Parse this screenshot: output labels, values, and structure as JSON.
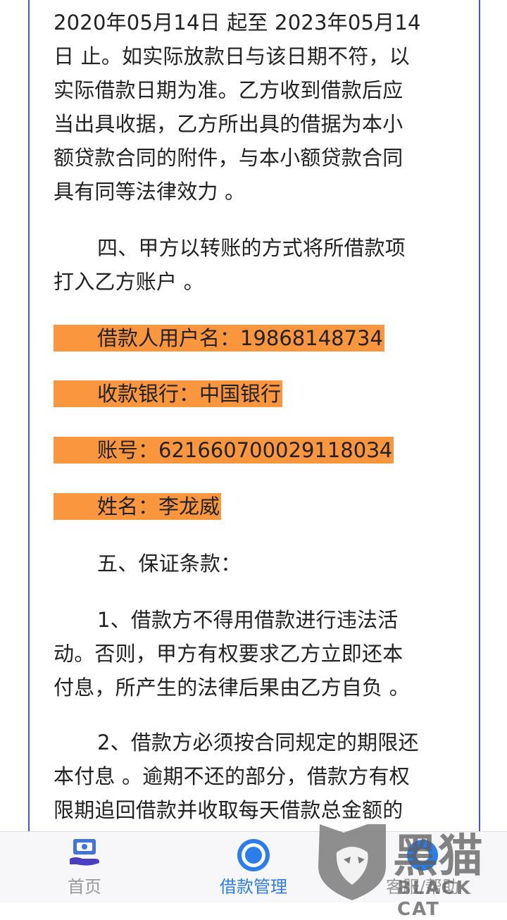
{
  "document": {
    "paragraph_3_lines": [
      "2020年05月14日 起至  2023年05月14",
      "日 止。如实际放款日与该日期不符，以",
      "实际借款日期为准。乙方收到借款后应",
      "当出具收据，乙方所出具的借据为本小",
      "额贷款合同的附件，与本小额贷款合同",
      "具有同等法律效力 。"
    ],
    "paragraph_4_lines": [
      "四、甲方以转账的方式将所借款项",
      "打入乙方账户 。"
    ],
    "account_info": {
      "username": "借款人用户名：19868148734",
      "bank": "收款银行：中国银行",
      "account_no": "账号：6216607000291180З4",
      "name": "姓名：李龙威"
    },
    "section_5_title": "五、保证条款：",
    "clause_1_lines": [
      "1、借款方不得用借款进行违法活",
      "动。否则，甲方有权要求乙方立即还本",
      "付息，所产生的法律后果由乙方自负 。"
    ],
    "clause_2_lines": [
      "2、借款方必须按合同规定的期限还",
      "本付息 。逾期不还的部分，借款方有权",
      "限期追回借款并收取每天借款总金额的"
    ]
  },
  "tabbar": {
    "tabs": [
      {
        "label": "首页",
        "color": "#999999"
      },
      {
        "label": "借款管理",
        "color": "#2b7de9"
      },
      {
        "label": "客服/帮助",
        "color": "#999999"
      }
    ]
  },
  "watermark": {
    "cn": "黑猫",
    "en": "BLACK CAT"
  },
  "colors": {
    "highlight": "#f9963e",
    "border": "#4b55c8",
    "active_tab": "#2b7de9"
  }
}
